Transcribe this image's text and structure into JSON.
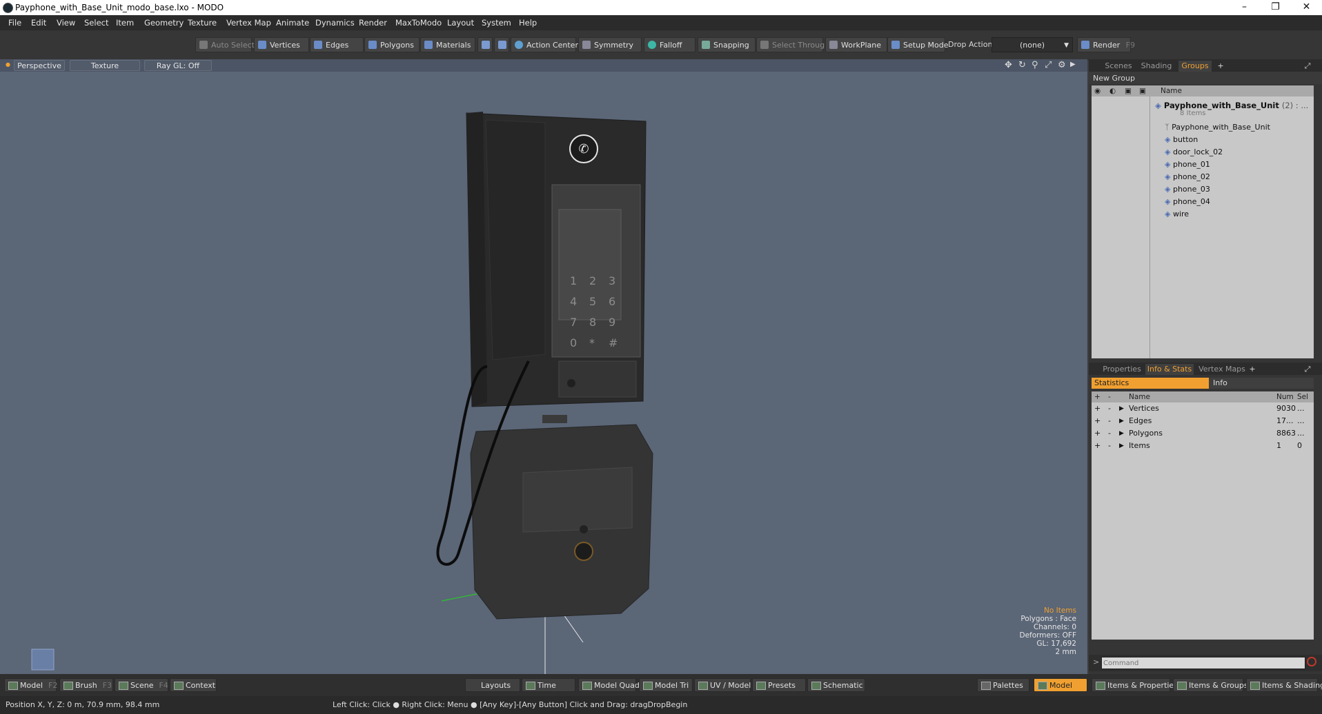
{
  "window": {
    "title": "Payphone_with_Base_Unit_modo_base.lxo - MODO"
  },
  "menu": [
    "File",
    "Edit",
    "View",
    "Select",
    "Item",
    "Geometry",
    "Texture",
    "Vertex Map",
    "Animate",
    "Dynamics",
    "Render",
    "MaxToModo",
    "Layout",
    "System",
    "Help"
  ],
  "toolbar": {
    "auto_select": "Auto Select",
    "vertices": "Vertices",
    "edges": "Edges",
    "polygons": "Polygons",
    "materials": "Materials",
    "action_center": "Action Center",
    "symmetry": "Symmetry",
    "falloff": "Falloff",
    "snapping": "Snapping",
    "select_through": "Select Through",
    "workplane": "WorkPlane",
    "setup_mode": "Setup Mode",
    "drop_action": "Drop Action",
    "drop_value": "(none)",
    "render": "Render",
    "render_key": "F9"
  },
  "viewport": {
    "tabs": [
      "Perspective",
      "Texture",
      "Ray GL: Off"
    ],
    "info": {
      "no_items": "No Items",
      "polygons": "Polygons : Face",
      "channels": "Channels: 0",
      "deformers": "Deformers: OFF",
      "gl": "GL: 17,692",
      "scale": "2 mm"
    },
    "keypad": [
      "1",
      "2",
      "3",
      "4",
      "5",
      "6",
      "7",
      "8",
      "9",
      "0",
      "*",
      "#"
    ]
  },
  "scene_panel": {
    "tabs": [
      "Scenes",
      "Shading",
      "Groups"
    ],
    "active_tab": "Groups",
    "new_group": "New Group",
    "name_header": "Name",
    "group_name": "Payphone_with_Base_Unit",
    "group_count": "(2) : ...",
    "group_items": "8 Items",
    "items": [
      "Payphone_with_Base_Unit",
      "button",
      "door_lock_02",
      "phone_01",
      "phone_02",
      "phone_03",
      "phone_04",
      "wire"
    ]
  },
  "stats_panel": {
    "tabs": [
      "Properties",
      "Info & Stats",
      "Vertex Maps"
    ],
    "active_tab": "Info & Stats",
    "subtabs": [
      "Statistics",
      "Info"
    ],
    "headers": {
      "name": "Name",
      "num": "Num",
      "sel": "Sel"
    },
    "rows": [
      {
        "name": "Vertices",
        "num": "9030",
        "sel": "..."
      },
      {
        "name": "Edges",
        "num": "17...",
        "sel": "..."
      },
      {
        "name": "Polygons",
        "num": "8863",
        "sel": "..."
      },
      {
        "name": "Items",
        "num": "1",
        "sel": "0"
      }
    ],
    "command_placeholder": "Command"
  },
  "bottom": {
    "left": [
      {
        "label": "Model",
        "key": "F2"
      },
      {
        "label": "Brush",
        "key": "F3"
      },
      {
        "label": "Scene",
        "key": "F4"
      },
      {
        "label": "Context",
        "key": ""
      }
    ],
    "center": [
      "Layouts",
      "Time",
      "Model Quad",
      "Model Tri",
      "UV / Model",
      "Presets",
      "Schematic"
    ],
    "right": [
      "Palettes",
      "Model",
      "Items & Properties",
      "Items & Groups",
      "Items & Shading"
    ]
  },
  "status": {
    "position": "Position X, Y, Z:  0 m, 70.9 mm, 98.4 mm",
    "hint": "Left Click: Click ●  Right Click: Menu ●  [Any Key]-[Any Button] Click and Drag: dragDropBegin"
  },
  "colors": {
    "accent": "#f0a030",
    "viewport_bg": "#5b6677"
  }
}
